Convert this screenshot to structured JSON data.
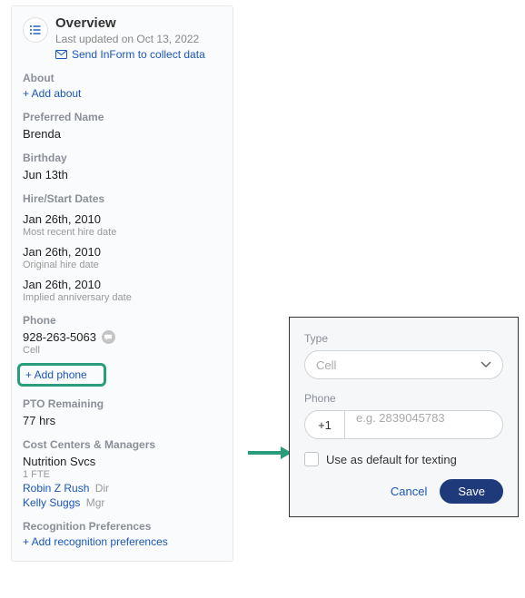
{
  "header": {
    "title": "Overview",
    "subtitle": "Last updated on Oct 13, 2022",
    "inform_link": "Send InForm to collect data"
  },
  "about": {
    "label": "About",
    "add_link": "+ Add about"
  },
  "preferred_name": {
    "label": "Preferred Name",
    "value": "Brenda"
  },
  "birthday": {
    "label": "Birthday",
    "value": "Jun 13th"
  },
  "hire": {
    "label": "Hire/Start Dates",
    "dates": [
      {
        "value": "Jan 26th, 2010",
        "note": "Most recent hire date"
      },
      {
        "value": "Jan 26th, 2010",
        "note": "Original hire date"
      },
      {
        "value": "Jan 26th, 2010",
        "note": "Implied anniversary date"
      }
    ]
  },
  "phone": {
    "label": "Phone",
    "number": "928-263-5063",
    "type": "Cell",
    "add_link": "+ Add phone"
  },
  "pto": {
    "label": "PTO Remaining",
    "value": "77 hrs"
  },
  "cost_centers": {
    "label": "Cost Centers & Managers",
    "dept": "Nutrition Svcs",
    "fte": "1 FTE",
    "managers": [
      {
        "name": "Robin Z Rush",
        "role": "Dir"
      },
      {
        "name": "Kelly Suggs",
        "role": "Mgr"
      }
    ]
  },
  "recognition": {
    "label": "Recognition Preferences",
    "add_link": "+ Add recognition preferences"
  },
  "popup": {
    "type_label": "Type",
    "type_value": "Cell",
    "phone_label": "Phone",
    "country_code": "+1",
    "phone_placeholder": "e.g. 2839045783",
    "checkbox_label": "Use as default for texting",
    "cancel": "Cancel",
    "save": "Save"
  }
}
